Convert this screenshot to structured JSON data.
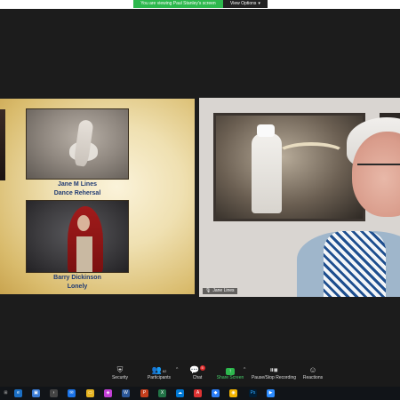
{
  "banner": {
    "share_text": "You are viewing Paul Stanley's screen",
    "view_options_label": "View Options"
  },
  "slide": {
    "photos": [
      {
        "author": "Jane M Lines",
        "title": "Dance Rehersal"
      },
      {
        "author": "Barry Dickinson",
        "title": "Lonely"
      }
    ]
  },
  "video": {
    "participant_name": "Jane Lines"
  },
  "controls": {
    "security": "Security",
    "participants": "Participants",
    "participants_count": "62",
    "chat": "Chat",
    "chat_badge": "5",
    "share_screen": "Share Screen",
    "record": "Pause/Stop Recording",
    "reactions": "Reactions"
  },
  "taskbar": {
    "icons": [
      "start",
      "search",
      "edge",
      "store",
      "explorer",
      "mail",
      "photos",
      "word",
      "powerpoint",
      "excel",
      "zoom",
      "photoshop",
      "chrome",
      "acrobat",
      "teams",
      "other"
    ]
  },
  "colors": {
    "share_green": "#2db84d",
    "caption_blue": "#1f3a73",
    "chat_badge_red": "#e32b2b"
  }
}
